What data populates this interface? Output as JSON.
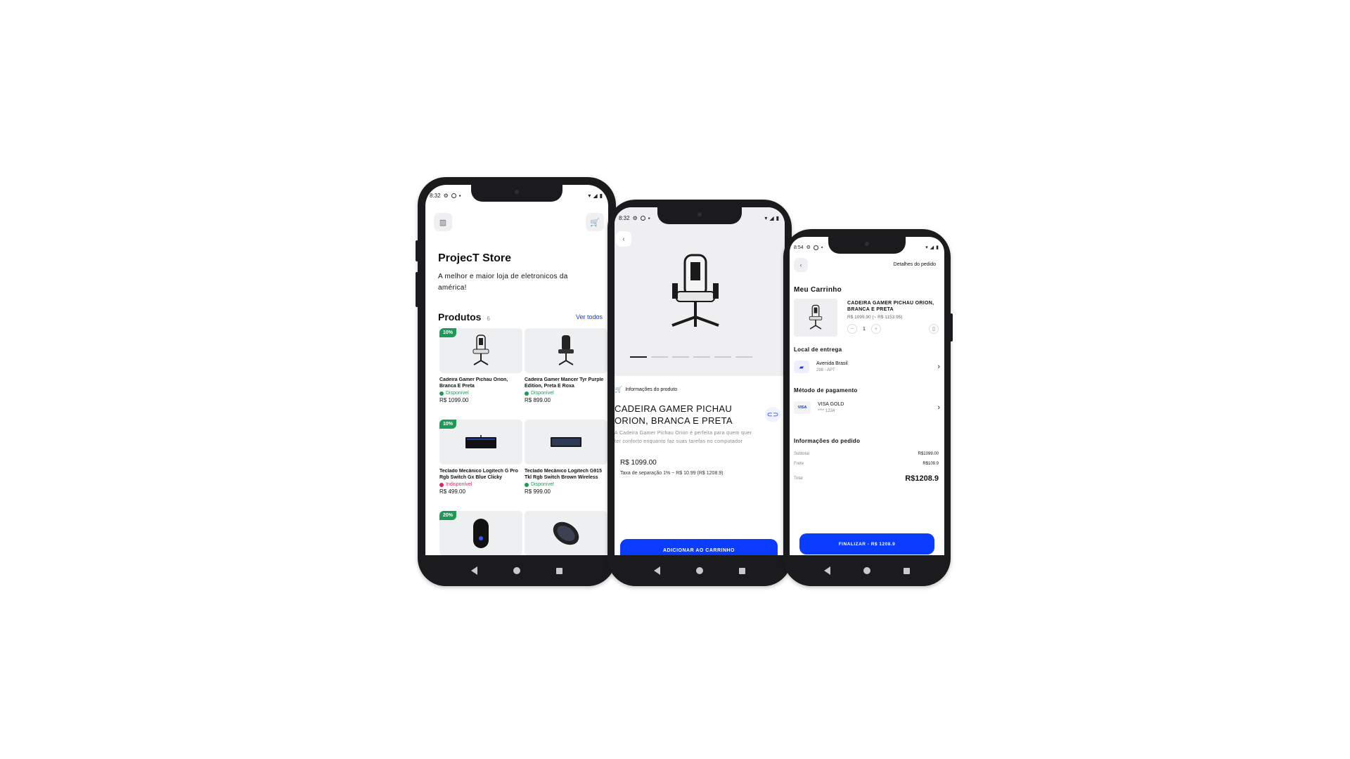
{
  "colors": {
    "accent": "#0a3cff",
    "available": "#1c9a56",
    "unavailable": "#e0245e",
    "badge": "#1c9a56"
  },
  "phone1": {
    "status_time": "8:32",
    "store_icon": "store-icon",
    "cart_icon": "cart-icon",
    "title": "ProjecT Store",
    "subtitle": "A melhor e maior loja de eletronicos da américa!",
    "section_title": "Produtos",
    "section_count": "6",
    "see_all": "Ver todos",
    "products": [
      {
        "badge": "10%",
        "name": "Cadeira Gamer Pichau Orion, Branca E Preta",
        "status": "Disponível",
        "price": "R$ 1099.00"
      },
      {
        "badge": "",
        "name": "Cadeira Gamer Mancer Tyr Purple Edition, Preta E Roxa",
        "status": "Disponível",
        "price": "R$ 899.00"
      },
      {
        "badge": "10%",
        "name": "Teclado Mecânico Logitech G Pro Rgb Switch Gx Blue Clicky",
        "status": "Indisponível",
        "price": "R$ 499.00"
      },
      {
        "badge": "",
        "name": "Teclado Mecânico Logitech G915 Tkl Rgb Switch Brown Wireless",
        "status": "Disponível",
        "price": "R$ 999.00"
      },
      {
        "badge": "20%",
        "name": "",
        "status": "",
        "price": ""
      },
      {
        "badge": "",
        "name": "",
        "status": "",
        "price": ""
      }
    ]
  },
  "phone2": {
    "status_time": "8:32",
    "section_label": "Informações do produto",
    "product_title": "CADEIRA GAMER PICHAU ORION, BRANCA E PRETA",
    "description": "A Cadeira Gamer Pichau Orion é perfeita para quem quer ter conforto enquanto faz suas tarefas no computador",
    "price": "R$ 1099.00",
    "fee": "Taxa de separação 1% ~ R$ 10.99 (R$ 1208.9)",
    "add_button": "ADICIONAR AO CARRINHO"
  },
  "phone3": {
    "status_time": "8:54",
    "header_right": "Detalhes do pedido",
    "cart_title": "Meu Carrinho",
    "item": {
      "name": "CADEIRA GAMER PICHAU ORION, BRANCA E PRETA",
      "price": "R$ 1099.90 (~ R$ 1153.95)",
      "qty": "1"
    },
    "delivery_title": "Local de entrega",
    "address": {
      "line1": "Avenida Brasil",
      "line2": "298 - APT"
    },
    "payment_title": "Método de pagamento",
    "card": {
      "brand": "VISA",
      "name": "VISA GOLD",
      "number": "**** 1234"
    },
    "order_info_title": "Informações do pedido",
    "subtotal_label": "Subtotal",
    "subtotal": "R$1099.00",
    "shipping_label": "Frete",
    "shipping": "R$109.9",
    "total_label": "Total",
    "total": "R$1208.9",
    "finish_button": "FINALIZAR - R$ 1208.9"
  }
}
